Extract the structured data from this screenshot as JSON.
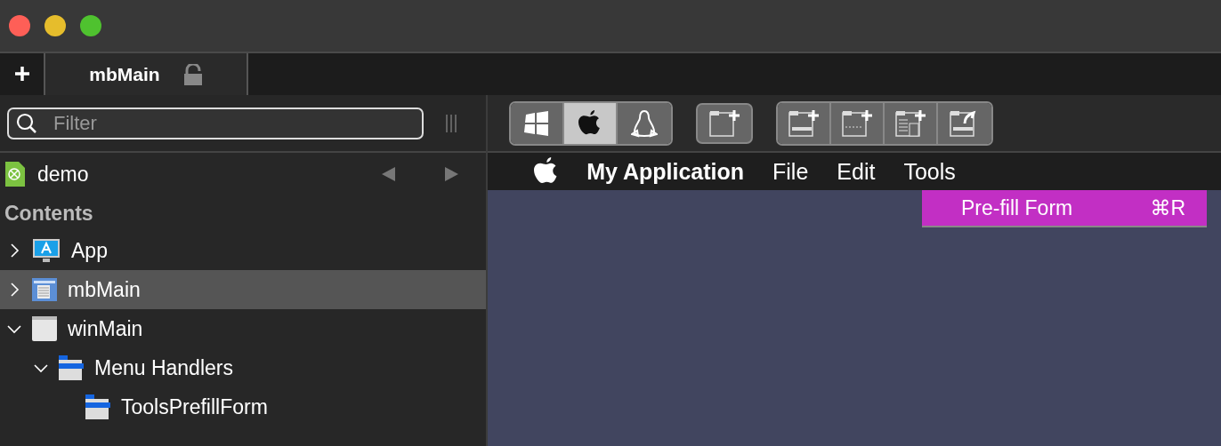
{
  "tabs": [
    {
      "label": "mbMain",
      "selected": true,
      "locked": false
    }
  ],
  "filter": {
    "placeholder": "Filter"
  },
  "platforms": [
    {
      "kind": "windows",
      "selected": false
    },
    {
      "kind": "mac",
      "selected": true
    },
    {
      "kind": "linux",
      "selected": false
    }
  ],
  "project": {
    "name": "demo"
  },
  "contents_heading": "Contents",
  "tree": [
    {
      "label": "App",
      "kind": "app",
      "expanded": false,
      "selected": false
    },
    {
      "label": "mbMain",
      "kind": "menubar",
      "expanded": false,
      "selected": true
    },
    {
      "label": "winMain",
      "kind": "window",
      "expanded": true,
      "selected": false,
      "children": [
        {
          "label": "Menu Handlers",
          "kind": "folder",
          "expanded": true,
          "selected": false,
          "children": [
            {
              "label": "ToolsPrefillForm",
              "kind": "folder",
              "selected": false
            }
          ]
        }
      ]
    }
  ],
  "menubar": {
    "app_name": "My Application",
    "menus": [
      {
        "label": "File"
      },
      {
        "label": "Edit"
      },
      {
        "label": "Tools"
      }
    ]
  },
  "dropdown": [
    {
      "label": "Pre-fill Form",
      "shortcut": "⌘R",
      "selected": true
    }
  ]
}
